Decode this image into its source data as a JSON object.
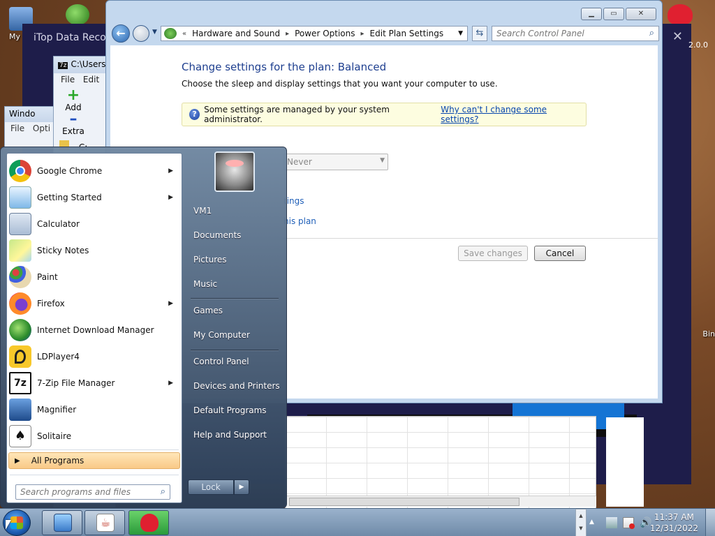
{
  "desktop": {
    "icons": [
      {
        "label": "My Co"
      },
      {
        "label": "Bin"
      }
    ]
  },
  "itop": {
    "title": "iTop Data Recov",
    "version_text": "2.0.0"
  },
  "sevenz": {
    "title": "C:\\Users\\",
    "menu_file": "File",
    "menu_edit": "Edit",
    "add_label": "Add",
    "extract_label": "Extra"
  },
  "win2": {
    "title": "Windo",
    "menu_file": "File",
    "menu_options": "Opti",
    "path_text": "C:"
  },
  "control_panel": {
    "breadcrumb": [
      "Hardware and Sound",
      "Power Options",
      "Edit Plan Settings"
    ],
    "search_placeholder": "Search Control Panel",
    "heading": "Change settings for the plan: Balanced",
    "subheading": "Choose the sleep and display settings that you want your computer to use.",
    "info_text": "Some settings are managed by your system administrator.",
    "info_link": "Why can't I change some settings?",
    "sleep_value": "Never",
    "link_advanced": "tings",
    "link_restore": "his plan",
    "save_label": "Save changes",
    "cancel_label": "Cancel"
  },
  "start_menu": {
    "programs": [
      {
        "label": "Google Chrome",
        "submenu": true,
        "icon": "chrome-icon"
      },
      {
        "label": "Getting Started",
        "submenu": true,
        "icon": "getting-started-icon"
      },
      {
        "label": "Calculator",
        "submenu": false,
        "icon": "calculator-icon"
      },
      {
        "label": "Sticky Notes",
        "submenu": false,
        "icon": "sticky-notes-icon"
      },
      {
        "label": "Paint",
        "submenu": false,
        "icon": "paint-icon"
      },
      {
        "label": "Firefox",
        "submenu": true,
        "icon": "firefox-icon"
      },
      {
        "label": "Internet Download Manager",
        "submenu": false,
        "icon": "idm-icon"
      },
      {
        "label": "LDPlayer4",
        "submenu": false,
        "icon": "ldplayer-icon"
      },
      {
        "label": "7-Zip File Manager",
        "submenu": true,
        "icon": "7zip-icon"
      },
      {
        "label": "Magnifier",
        "submenu": false,
        "icon": "magnifier-icon"
      },
      {
        "label": "Solitaire",
        "submenu": false,
        "icon": "solitaire-icon"
      }
    ],
    "all_programs": "All Programs",
    "search_placeholder": "Search programs and files",
    "right": {
      "user": "VM1",
      "documents": "Documents",
      "pictures": "Pictures",
      "music": "Music",
      "games": "Games",
      "computer": "My Computer",
      "control_panel": "Control Panel",
      "devices": "Devices and Printers",
      "default_programs": "Default Programs",
      "help": "Help and Support"
    },
    "lock_label": "Lock"
  },
  "taskbar": {
    "time": "11:37 AM",
    "date": "12/31/2022"
  }
}
